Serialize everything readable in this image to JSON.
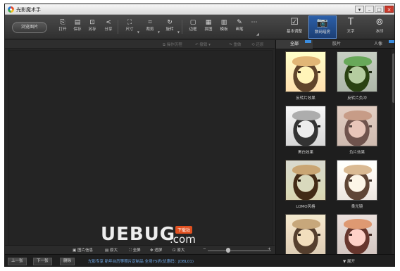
{
  "titlebar": {
    "title": "光影魔术手",
    "controls": [
      "▾",
      "–",
      "□",
      "×"
    ]
  },
  "toolbar": {
    "browse_label": "浏览图片",
    "tools": [
      {
        "label": "打开",
        "icon": "open-icon",
        "glyph": "⎘"
      },
      {
        "label": "保存",
        "icon": "save-icon",
        "glyph": "▤"
      },
      {
        "label": "另存",
        "icon": "save-as-icon",
        "glyph": "⊡"
      },
      {
        "label": "分享",
        "icon": "share-icon",
        "glyph": "<"
      },
      {
        "label": "尺寸",
        "icon": "resize-icon",
        "glyph": "⛶"
      },
      {
        "label": "裁剪",
        "icon": "crop-icon",
        "glyph": "⌗"
      },
      {
        "label": "旋转",
        "icon": "rotate-icon",
        "glyph": "↻"
      },
      {
        "label": "边框",
        "icon": "border-icon",
        "glyph": "▢"
      },
      {
        "label": "拼图",
        "icon": "collage-icon",
        "glyph": "▦"
      },
      {
        "label": "模板",
        "icon": "template-icon",
        "glyph": "▥"
      },
      {
        "label": "画笔",
        "icon": "brush-icon",
        "glyph": "✎"
      },
      {
        "label": "...",
        "icon": "more-icon",
        "glyph": "⋯"
      }
    ],
    "mode_tabs": [
      {
        "label": "基本调整",
        "icon": "adjust-icon",
        "glyph": "☑"
      },
      {
        "label": "数码暗房",
        "icon": "camera-icon",
        "glyph": "📷"
      },
      {
        "label": "文字",
        "icon": "text-icon",
        "glyph": "T"
      },
      {
        "label": "水印",
        "icon": "watermark-icon",
        "glyph": "⊚"
      }
    ]
  },
  "action_bar": {
    "actions": [
      "操作历程",
      "撤销",
      "重做",
      "还原"
    ]
  },
  "right_panel": {
    "categories": [
      "全部",
      "胶片",
      "人像"
    ],
    "effects": [
      {
        "label": "反转片效果"
      },
      {
        "label": "反转片负冲"
      },
      {
        "label": "黑白效果"
      },
      {
        "label": "负片效果"
      },
      {
        "label": "LOMO风格"
      },
      {
        "label": "柔光镜"
      },
      {
        "label": ""
      },
      {
        "label": ""
      }
    ]
  },
  "bottom_tools": {
    "items": [
      "图片信息",
      "原大",
      "全屏",
      "适屏",
      "原大"
    ],
    "zoom_minus": "−",
    "zoom_plus": "+"
  },
  "statusbar": {
    "prev_label": "上一张",
    "next_label": "下一张",
    "delete_label": "删除",
    "message": "光影专享  新年台历等照片定制品  全场75折(优惠码：JDBL01)",
    "expand_label": "展开",
    "expand_arrow": "▼"
  },
  "watermark": {
    "logo": "UEBUG",
    "suffix": ".com",
    "badge": "下载站"
  }
}
